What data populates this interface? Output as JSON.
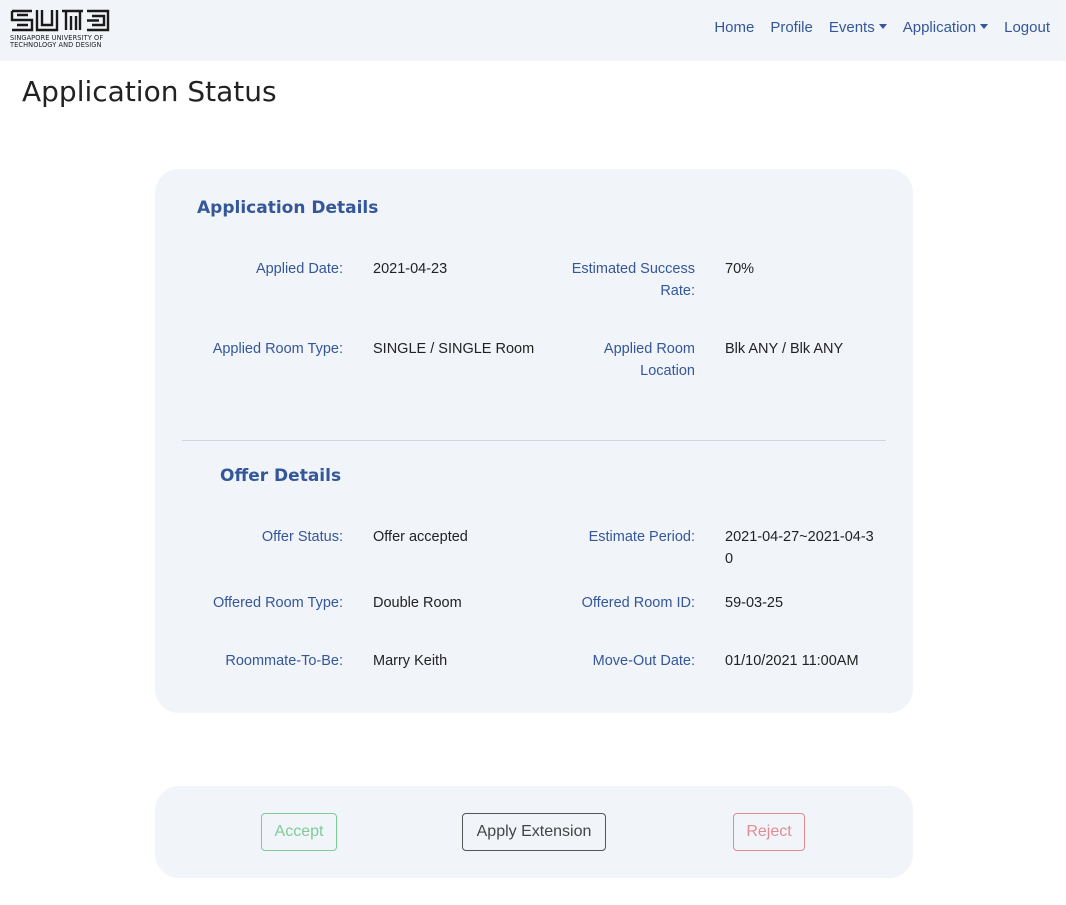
{
  "brand": {
    "logo_text_line1": "SINGAPORE UNIVERSITY OF",
    "logo_text_line2": "TECHNOLOGY AND DESIGN"
  },
  "nav": {
    "home": "Home",
    "profile": "Profile",
    "events": "Events",
    "application": "Application",
    "logout": "Logout"
  },
  "page": {
    "title": "Application Status"
  },
  "application_details": {
    "title": "Application Details",
    "applied_date_label": "Applied Date:",
    "applied_date": "2021-04-23",
    "success_rate_label": "Estimated Success Rate:",
    "success_rate": "70%",
    "room_type_label": "Applied Room Type:",
    "room_type": "SINGLE / SINGLE Room",
    "room_location_label": "Applied Room Location",
    "room_location": "Blk ANY / Blk ANY"
  },
  "offer_details": {
    "title": "Offer Details",
    "offer_status_label": "Offer Status:",
    "offer_status": "Offer accepted",
    "estimate_period_label": "Estimate Period:",
    "estimate_period": "2021-04-27~2021-04-30",
    "offered_room_type_label": "Offered Room Type:",
    "offered_room_type": "Double Room",
    "offered_room_id_label": "Offered Room ID:",
    "offered_room_id": "59-03-25",
    "roommate_label": "Roommate-To-Be:",
    "roommate": "Marry Keith",
    "move_out_label": "Move-Out Date:",
    "move_out": "01/10/2021 11:00AM"
  },
  "actions": {
    "accept": "Accept",
    "extension": "Apply Extension",
    "reject": "Reject"
  },
  "colors": {
    "accent": "#34579a",
    "panel": "#f1f4f9",
    "success": "#7fcb98",
    "danger": "#e48a93"
  }
}
